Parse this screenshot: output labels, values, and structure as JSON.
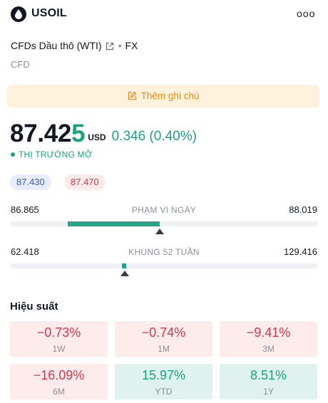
{
  "header": {
    "symbol": "USOIL",
    "more_label": "ooo",
    "logo_icon": "oil-drop-icon",
    "more_icon": "more-dots-icon"
  },
  "instrument": {
    "name": "CFDs Dầu thô (WTI)",
    "external_link_icon": "external-link-icon",
    "separator": "•",
    "exchange": "FX",
    "type": "CFD"
  },
  "note_button": {
    "label": "Thêm ghi chú",
    "icon": "edit-note-icon"
  },
  "quote": {
    "price_main": "87.42",
    "price_last_digit": "5",
    "currency": "USD",
    "change": "0.346 (0.40%)",
    "market_status": "THỊ TRƯỜNG MỞ"
  },
  "bid_ask": {
    "bid": "87.430",
    "ask": "87.470"
  },
  "day_range": {
    "label": "PHẠM VI NGÀY",
    "low": "86.865",
    "high": "88.019",
    "low_value": 86.865,
    "high_value": 88.019,
    "open_value": 87.079,
    "current_value": 87.425
  },
  "week52_range": {
    "label": "KHUNG 52 TUẦN",
    "low": "62.418",
    "high": "129.416",
    "low_value": 62.418,
    "high_value": 129.416,
    "open_value": 86.7,
    "current_value": 87.425
  },
  "performance": {
    "title": "Hiệu suất",
    "items": [
      {
        "value": "−0.73%",
        "period": "1W",
        "direction": "negative"
      },
      {
        "value": "−0.74%",
        "period": "1M",
        "direction": "negative"
      },
      {
        "value": "−9.41%",
        "period": "3M",
        "direction": "negative"
      },
      {
        "value": "−16.09%",
        "period": "6M",
        "direction": "negative"
      },
      {
        "value": "15.97%",
        "period": "YTD",
        "direction": "positive"
      },
      {
        "value": "8.51%",
        "period": "1Y",
        "direction": "positive"
      }
    ]
  },
  "colors": {
    "accent_green": "#1aa37f",
    "accent_red": "#e0344a",
    "note_orange": "#f28c18",
    "bid_blue": "#3a5ad6"
  }
}
